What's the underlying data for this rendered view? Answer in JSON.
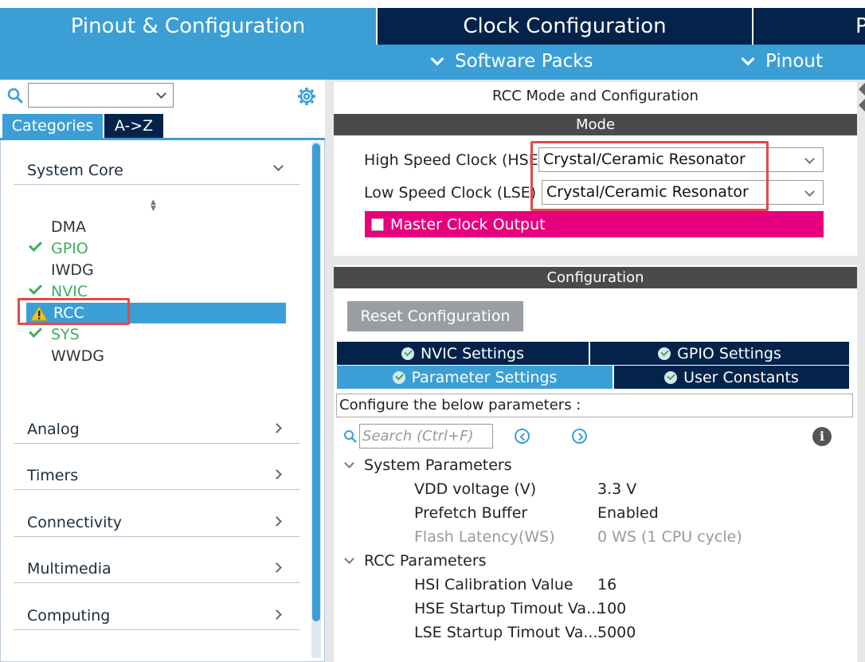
{
  "tabs": {
    "pinout_config": "Pinout & Configuration",
    "clock_config": "Clock Configuration",
    "project_partial": "P"
  },
  "submenu": {
    "software_packs": "Software Packs",
    "pinout": "Pinout"
  },
  "left": {
    "search_value": "",
    "categories_btn": "Categories",
    "az_btn": "A->Z",
    "system_core": "System Core",
    "peripherals": [
      {
        "label": "DMA",
        "status": "none"
      },
      {
        "label": "GPIO",
        "status": "ok"
      },
      {
        "label": "IWDG",
        "status": "none"
      },
      {
        "label": "NVIC",
        "status": "ok"
      },
      {
        "label": "RCC",
        "status": "warning"
      },
      {
        "label": "SYS",
        "status": "ok"
      },
      {
        "label": "WWDG",
        "status": "none"
      }
    ],
    "categories": [
      "Analog",
      "Timers",
      "Connectivity",
      "Multimedia",
      "Computing"
    ]
  },
  "mode": {
    "title": "RCC Mode and Configuration",
    "section": "Mode",
    "hse_label": "High Speed Clock (HSE",
    "hse_value": "Crystal/Ceramic Resonator",
    "lse_label": "Low Speed Clock (LSE)",
    "lse_value": "Crystal/Ceramic Resonator",
    "mco_label": "Master Clock Output"
  },
  "config": {
    "section": "Configuration",
    "reset_btn": "Reset Configuration",
    "tabs": {
      "nvic": "NVIC Settings",
      "gpio": "GPIO Settings",
      "params": "Parameter Settings",
      "user": "User Constants"
    },
    "configure_label": "Configure the below parameters :",
    "search_placeholder": "Search (Ctrl+F)",
    "groups": {
      "system": "System Parameters",
      "rcc": "RCC Parameters"
    },
    "params": {
      "vdd_name": "VDD voltage (V)",
      "vdd_val": "3.3 V",
      "prefetch_name": "Prefetch Buffer",
      "prefetch_val": "Enabled",
      "flash_name": "Flash Latency(WS)",
      "flash_val": "0 WS (1 CPU cycle)",
      "hsi_name": "HSI Calibration Value",
      "hsi_val": "16",
      "hse_name": "HSE Startup Timout Va...",
      "hse_val": "100",
      "lse_name": "LSE Startup Timout Va...",
      "lse_val": "5000"
    }
  },
  "colors": {
    "accent_blue": "#3b9fd6",
    "navy": "#03234b",
    "magenta": "#e6007e",
    "ok_green": "#3fae5a",
    "highlight_red": "#e5484d"
  }
}
